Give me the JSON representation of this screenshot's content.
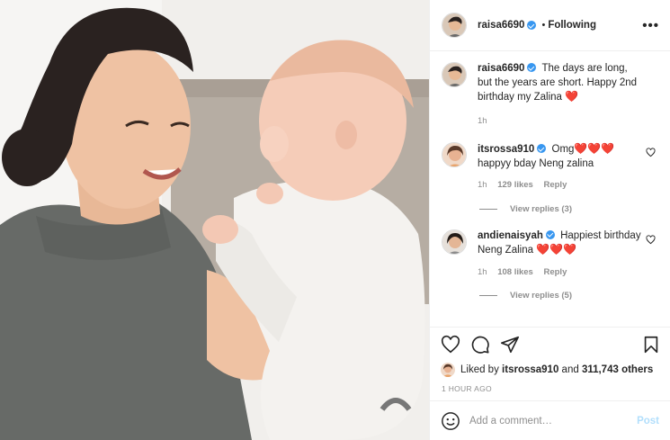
{
  "header": {
    "username": "raisa6690",
    "separator": "•",
    "follow_status": "Following",
    "more_label": "•••"
  },
  "caption": {
    "username": "raisa6690",
    "text": "The days are long, but the years are short. Happy 2nd birthday my Zalina",
    "emoji": "❤️",
    "time": "1h"
  },
  "comments": [
    {
      "username": "itsrossa910",
      "text": "Omg",
      "emoji": "❤️❤️❤️",
      "text2": "happyy bday Neng zalina",
      "time": "1h",
      "likes": "129 likes",
      "reply_label": "Reply",
      "view_replies": "View replies (3)"
    },
    {
      "username": "andienaisyah",
      "text": "Happiest birthday Neng Zalina",
      "emoji": "❤️❤️❤️",
      "time": "1h",
      "likes": "108 likes",
      "reply_label": "Reply",
      "view_replies": "View replies (5)"
    }
  ],
  "likes_line": {
    "prefix": "Liked by",
    "user": "itsrossa910",
    "middle": "and",
    "count": "311,743 others"
  },
  "timestamp": "1 HOUR AGO",
  "add_comment": {
    "placeholder": "Add a comment…",
    "post_label": "Post"
  },
  "icons": [
    "heart-icon",
    "comment-icon",
    "share-icon",
    "bookmark-icon",
    "emoji-icon",
    "more-icon",
    "verified-badge-icon"
  ],
  "colors": {
    "verified": "#3897f0",
    "heart": "#e0245e",
    "post_disabled": "#b2dffc",
    "muted": "#8e8e8e"
  }
}
